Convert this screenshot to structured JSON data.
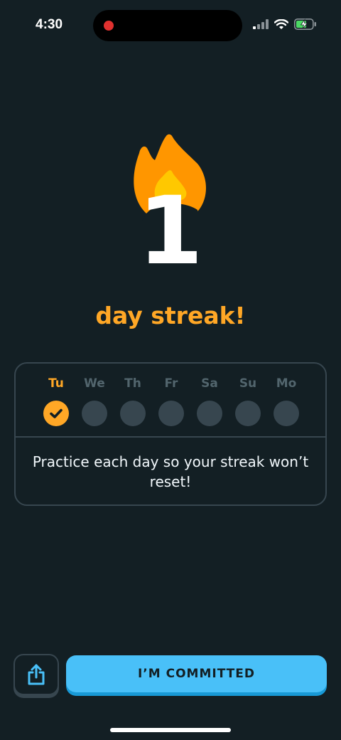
{
  "status_bar": {
    "time": "4:30",
    "icons": [
      "cellular-signal-icon",
      "wifi-icon",
      "battery-charging-icon"
    ],
    "recording_indicator_color": "#e0312f"
  },
  "streak": {
    "count": "1",
    "label": "day streak!",
    "flame_colors": {
      "outer": "#ff9600",
      "inner": "#ffc800"
    },
    "accent_color": "#ffa726"
  },
  "week": {
    "days": [
      {
        "label": "Tu",
        "completed": true
      },
      {
        "label": "We",
        "completed": false
      },
      {
        "label": "Th",
        "completed": false
      },
      {
        "label": "Fr",
        "completed": false
      },
      {
        "label": "Sa",
        "completed": false
      },
      {
        "label": "Su",
        "completed": false
      },
      {
        "label": "Mo",
        "completed": false
      }
    ],
    "message": "Practice each day so your streak won’t reset!"
  },
  "actions": {
    "share_icon": "share-icon",
    "commit_label": "I’M COMMITTED",
    "commit_color": "#49c0f8"
  }
}
